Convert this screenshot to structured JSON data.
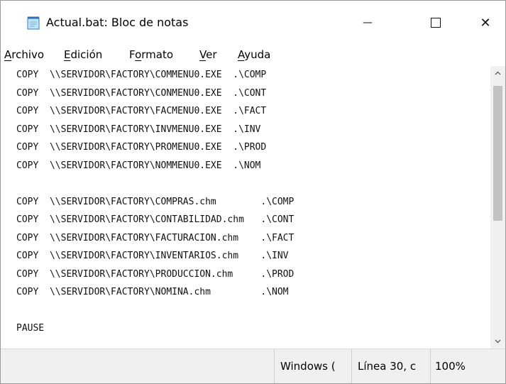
{
  "window": {
    "title": "Actual.bat: Bloc de notas",
    "controls": {
      "minimize": "—",
      "close": "✕"
    }
  },
  "menu": [
    {
      "accel": "A",
      "rest": "rchivo"
    },
    {
      "accel": "E",
      "rest": "dición"
    },
    {
      "pre": "F",
      "accel": "o",
      "rest": "rmato"
    },
    {
      "accel": "V",
      "rest": "er"
    },
    {
      "accel": "A",
      "rest": "yuda"
    }
  ],
  "editor": {
    "lines": [
      "COPY  \\\\SERVIDOR\\FACTORY\\COMMENU0.EXE  .\\COMP",
      "COPY  \\\\SERVIDOR\\FACTORY\\CONMENU0.EXE  .\\CONT",
      "COPY  \\\\SERVIDOR\\FACTORY\\FACMENU0.EXE  .\\FACT",
      "COPY  \\\\SERVIDOR\\FACTORY\\INVMENU0.EXE  .\\INV",
      "COPY  \\\\SERVIDOR\\FACTORY\\PROMENU0.EXE  .\\PROD",
      "COPY  \\\\SERVIDOR\\FACTORY\\NOMMENU0.EXE  .\\NOM",
      "",
      "COPY  \\\\SERVIDOR\\FACTORY\\COMPRAS.chm        .\\COMP",
      "COPY  \\\\SERVIDOR\\FACTORY\\CONTABILIDAD.chm   .\\CONT",
      "COPY  \\\\SERVIDOR\\FACTORY\\FACTURACION.chm    .\\FACT",
      "COPY  \\\\SERVIDOR\\FACTORY\\INVENTARIOS.chm    .\\INV",
      "COPY  \\\\SERVIDOR\\FACTORY\\PRODUCCION.chm     .\\PROD",
      "COPY  \\\\SERVIDOR\\FACTORY\\NOMINA.chm         .\\NOM",
      "",
      "PAUSE",
      ""
    ]
  },
  "status": {
    "encoding": "Windows (",
    "position": "Línea 30, c",
    "zoom": "100%"
  },
  "colors": {
    "statusbar": "#f0f0f0",
    "scroll_thumb": "#c2c2c2"
  }
}
